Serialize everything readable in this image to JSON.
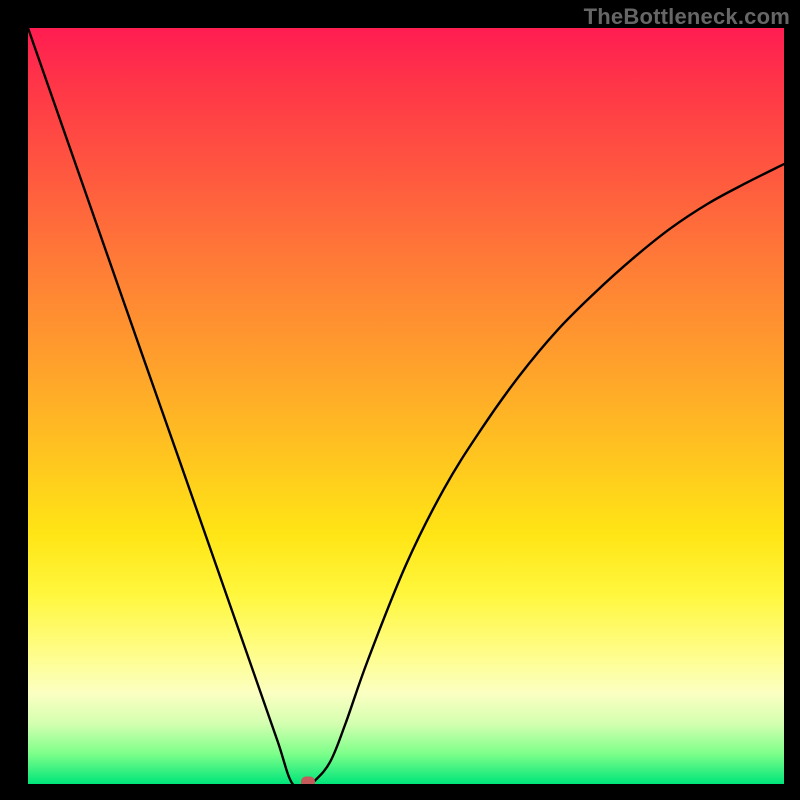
{
  "watermark": "TheBottleneck.com",
  "chart_data": {
    "type": "line",
    "title": "",
    "xlabel": "",
    "ylabel": "",
    "xlim": [
      0,
      100
    ],
    "ylim": [
      0,
      100
    ],
    "grid": false,
    "legend": false,
    "series": [
      {
        "name": "bottleneck-curve",
        "x": [
          0,
          5,
          10,
          15,
          20,
          25,
          30,
          33,
          35,
          37,
          38,
          40,
          42,
          45,
          50,
          55,
          60,
          65,
          70,
          75,
          80,
          85,
          90,
          95,
          100
        ],
        "y": [
          100,
          85.7,
          71.4,
          57.1,
          42.9,
          28.6,
          14.3,
          5.7,
          0,
          0,
          0.5,
          3,
          8,
          16.5,
          29,
          39,
          47,
          54,
          60,
          65,
          69.5,
          73.5,
          76.8,
          79.5,
          82
        ]
      }
    ],
    "annotations": [
      {
        "type": "marker",
        "name": "optimal-point",
        "x": 37,
        "y": 0,
        "color": "#c45a5a"
      }
    ],
    "background": "rainbow-vertical-gradient"
  }
}
